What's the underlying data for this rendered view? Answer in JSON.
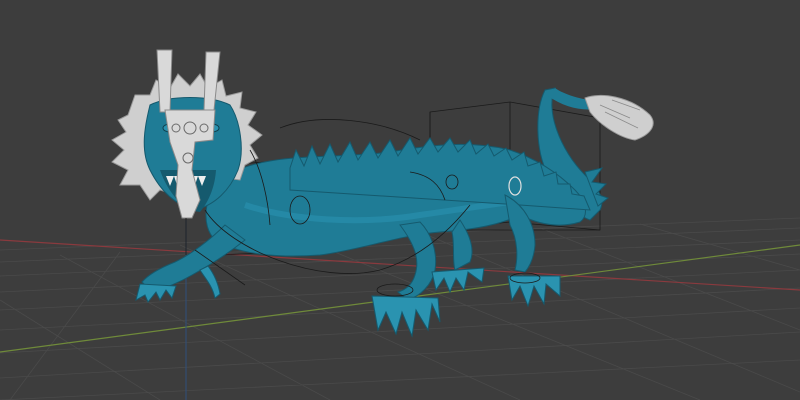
{
  "viewport": {
    "background_color": "#3d3d3d",
    "grid_color": "#4a4a4a",
    "x_axis_color": "#8a3a3e",
    "y_axis_color": "#6f8a3a"
  },
  "model": {
    "body_color": "#1f7c96",
    "body_highlight": "#2a93b0",
    "body_shadow": "#155a6e",
    "mane_color": "#cfcfcf",
    "overlay_color": "#d9d9d9",
    "wire_color": "#1a1a1a"
  },
  "icons": {
    "object": "dragon-mesh",
    "rig": "armature-bones"
  }
}
